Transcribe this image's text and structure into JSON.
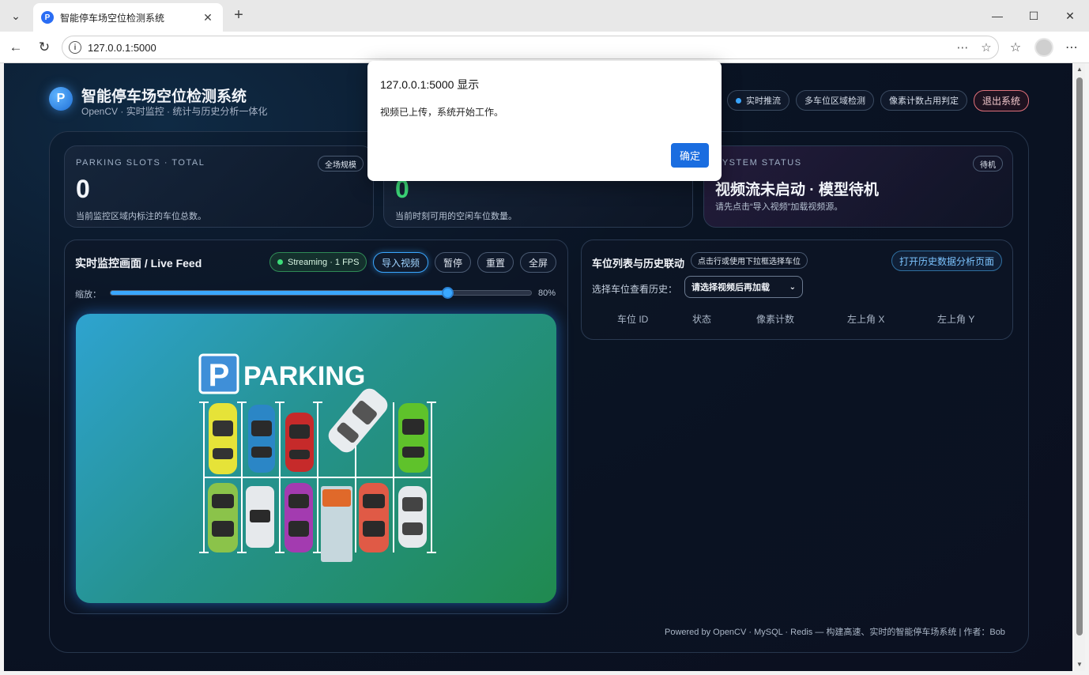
{
  "browser": {
    "tab_title": "智能停车场空位检测系统",
    "favicon_letter": "P",
    "url": "127.0.0.1:5000"
  },
  "header": {
    "logo_letter": "P",
    "title": "智能停车场空位检测系统",
    "subtitle": "OpenCV · 实时监控 · 统计与历史分析一体化",
    "pills": [
      "实时推流",
      "多车位区域检测",
      "像素计数占用判定"
    ],
    "logout": "退出系统"
  },
  "stats": {
    "total": {
      "label": "PARKING SLOTS · TOTAL",
      "tag": "全场规模",
      "value": "0",
      "desc": "当前监控区域内标注的车位总数。"
    },
    "free": {
      "value": "0",
      "desc": "当前时刻可用的空闲车位数量。"
    },
    "status": {
      "label": "SYSTEM STATUS",
      "tag": "待机",
      "value": "视频流未启动 · 模型待机",
      "desc": "请先点击“导入视频”加载视频源。"
    }
  },
  "feed": {
    "title": "实时监控画面 / Live Feed",
    "streaming": "Streaming · 1 FPS",
    "buttons": {
      "import": "导入视频",
      "pause": "暂停",
      "reset": "重置",
      "fullscreen": "全屏"
    },
    "zoom_label": "缩放：",
    "zoom_value": "80%",
    "zoom_fraction": 0.8,
    "parking_sign": "PARKING",
    "parking_letter": "P"
  },
  "slots": {
    "title": "车位列表与历史联动",
    "hint": "点击行或使用下拉框选择车位",
    "history_button": "打开历史数据分析页面",
    "select_label": "选择车位查看历史：",
    "select_value": "请选择视频后再加载",
    "columns": [
      "车位 ID",
      "状态",
      "像素计数",
      "左上角 X",
      "左上角 Y"
    ]
  },
  "footer": "Powered by OpenCV · MySQL · Redis — 构建高速、实时的智能停车场系统 | 作者：Bob",
  "dialog": {
    "title": "127.0.0.1:5000 显示",
    "message": "视频已上传，系统开始工作。",
    "ok": "确定"
  },
  "colors": {
    "accent": "#3aa7ff",
    "success": "#3ddc7a",
    "danger": "#e0707a"
  }
}
